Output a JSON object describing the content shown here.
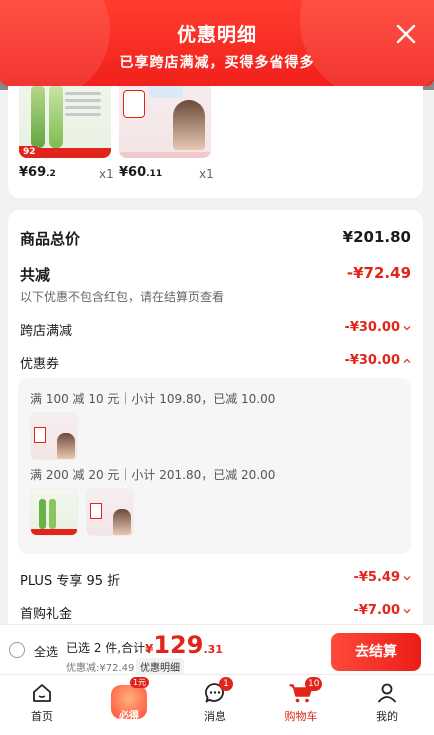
{
  "header": {
    "title": "优惠明细",
    "subtitle": "已享跨店满减，买得多省得多"
  },
  "products": [
    {
      "price_int": "¥69",
      "price_dec": ".2",
      "qty": "x1",
      "badge": "92"
    },
    {
      "price_int": "¥60",
      "price_dec": ".11",
      "qty": "x1"
    }
  ],
  "summary": {
    "total_label": "商品总价",
    "total_value": "¥201.80",
    "discount_label": "共减",
    "discount_value": "-¥72.49",
    "note": "以下优惠不包含红包，请在结算页查看",
    "cross_store_label": "跨店满减",
    "cross_store_value": "-¥30.00",
    "coupon_label": "优惠券",
    "coupon_value": "-¥30.00",
    "coupon_lines": [
      "满 100 减 10 元｜小计 109.80，已减 10.00",
      "满 200 减 20 元｜小计 201.80，已减 20.00"
    ],
    "plus_label": "PLUS 专享 95 折",
    "plus_value": "-¥5.49",
    "first_label": "首购礼金",
    "first_value": "-¥7.00"
  },
  "checkout": {
    "select_all": "全选",
    "selected_summary": "已选 2 件,合计:",
    "currency": "¥",
    "total_int": "129",
    "total_dec": ".31",
    "saved": "优惠减:¥72.49",
    "detail_chip": "优惠明细",
    "button": "去结算"
  },
  "nav": {
    "home": "首页",
    "promo_text": "必得",
    "promo_badge": "1元",
    "messages": "消息",
    "messages_badge": "1",
    "cart": "购物车",
    "cart_badge": "10",
    "mine": "我的"
  },
  "colors": {
    "accent": "#e1251b",
    "header": "#f1201b"
  }
}
